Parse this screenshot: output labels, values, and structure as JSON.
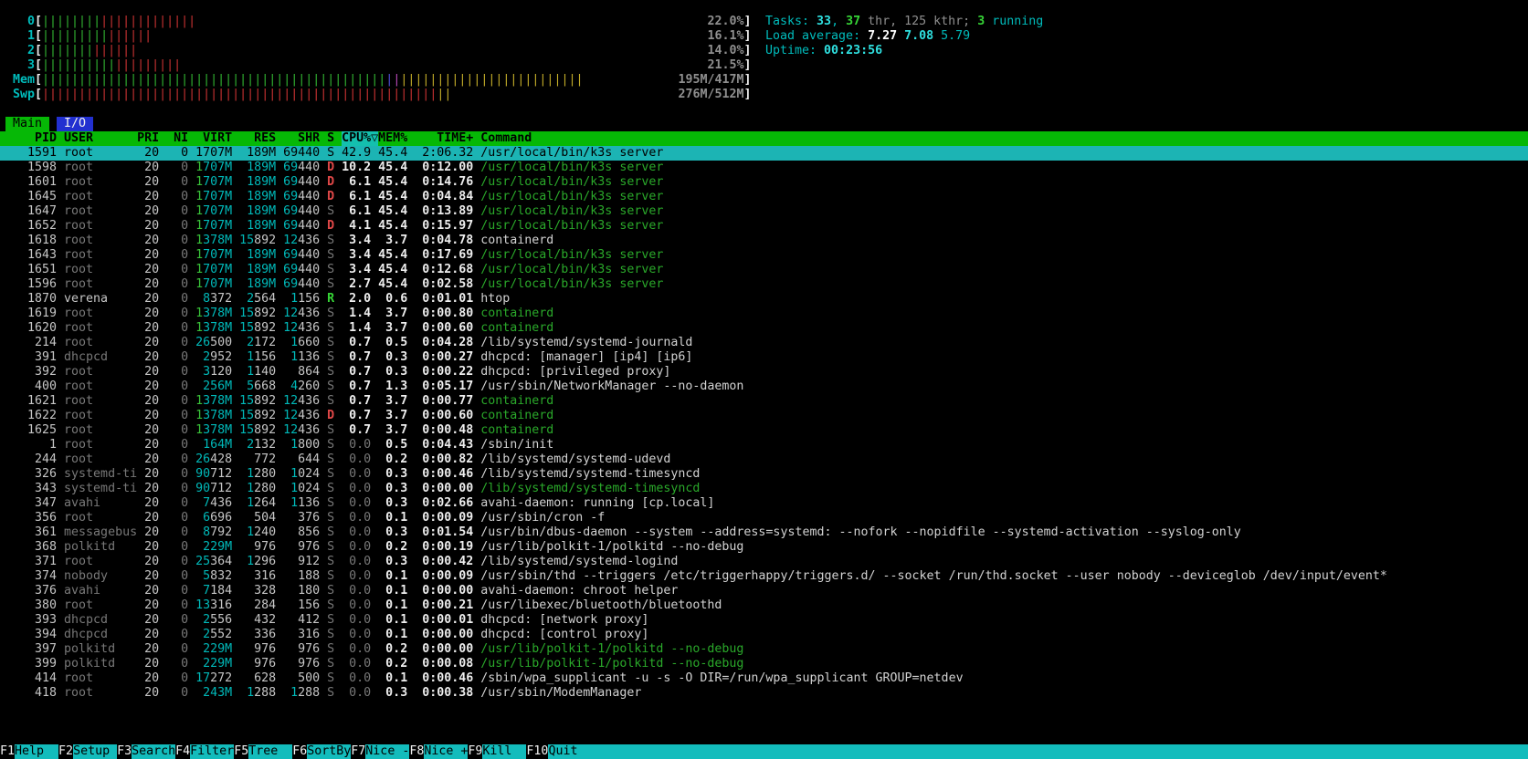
{
  "meters": {
    "cpus": [
      {
        "label": "0",
        "percent": "22.0%",
        "segments": [
          {
            "color": "bar_green",
            "count": 8
          },
          {
            "color": "bar_red",
            "count": 13
          }
        ]
      },
      {
        "label": "1",
        "percent": "16.1%",
        "segments": [
          {
            "color": "bar_green",
            "count": 9
          },
          {
            "color": "bar_red",
            "count": 6
          }
        ]
      },
      {
        "label": "2",
        "percent": "14.0%",
        "segments": [
          {
            "color": "bar_green",
            "count": 7
          },
          {
            "color": "bar_red",
            "count": 6
          }
        ]
      },
      {
        "label": "3",
        "percent": "21.5%",
        "segments": [
          {
            "color": "bar_green",
            "count": 10
          },
          {
            "color": "bar_red",
            "count": 9
          }
        ]
      }
    ],
    "mem": {
      "label": "Mem",
      "value": "195M/417M",
      "segments": [
        {
          "color": "bar_green",
          "count": 47
        },
        {
          "color": "bar_blue",
          "count": 1
        },
        {
          "color": "bar_magenta",
          "count": 1
        },
        {
          "color": "bar_yellow",
          "count": 25
        }
      ]
    },
    "swp": {
      "label": "Swp",
      "value": "276M/512M",
      "segments": [
        {
          "color": "bar_red",
          "count": 54
        },
        {
          "color": "bar_yellow",
          "count": 2
        }
      ]
    }
  },
  "summary": {
    "tasks_line": [
      {
        "t": "Tasks: ",
        "c": "label"
      },
      {
        "t": "33",
        "c": "value"
      },
      {
        "t": ", ",
        "c": "label"
      },
      {
        "t": "37",
        "c": "ok"
      },
      {
        "t": " thr, 125 kthr; ",
        "c": "shadow"
      },
      {
        "t": "3",
        "c": "ok"
      },
      {
        "t": " running",
        "c": "label"
      }
    ],
    "load_line": [
      {
        "t": "Load average: ",
        "c": "label"
      },
      {
        "t": "7.27 ",
        "c": "white"
      },
      {
        "t": "7.08 ",
        "c": "value"
      },
      {
        "t": "5.79",
        "c": "label"
      }
    ],
    "uptime_line": [
      {
        "t": "Uptime: ",
        "c": "label"
      },
      {
        "t": "00:23:56",
        "c": "value"
      }
    ]
  },
  "tabs": [
    {
      "label": "Main",
      "active": true
    },
    {
      "label": "I/O",
      "active": false
    }
  ],
  "process_table": {
    "columns": {
      "pid": "PID",
      "user": "USER",
      "pri": "PRI",
      "ni": "NI",
      "virt": "VIRT",
      "res": "RES",
      "shr": "SHR",
      "state": "S",
      "cpu": "CPU%",
      "mem": "MEM%",
      "time": "TIME+",
      "command": "Command"
    },
    "sort_column": "cpu",
    "sort_arrow": "▽",
    "rows": [
      {
        "pid": "1591",
        "user": "root",
        "pri": "20",
        "ni": "0",
        "virt": "1707M",
        "res": "189M",
        "shr": "69440",
        "state": "S",
        "cpu": "42.9",
        "mem": "45.4",
        "time": "2:06.32",
        "command": "/usr/local/bin/k3s server",
        "thread": false,
        "selected": true,
        "current_user": false
      },
      {
        "pid": "1598",
        "user": "root",
        "pri": "20",
        "ni": "0",
        "virt": "1707M",
        "res": "189M",
        "shr": "69440",
        "state": "D",
        "cpu": "10.2",
        "mem": "45.4",
        "time": "0:12.00",
        "command": "/usr/local/bin/k3s server",
        "thread": true,
        "selected": false,
        "current_user": false
      },
      {
        "pid": "1601",
        "user": "root",
        "pri": "20",
        "ni": "0",
        "virt": "1707M",
        "res": "189M",
        "shr": "69440",
        "state": "D",
        "cpu": "6.1",
        "mem": "45.4",
        "time": "0:14.76",
        "command": "/usr/local/bin/k3s server",
        "thread": true,
        "selected": false,
        "current_user": false
      },
      {
        "pid": "1645",
        "user": "root",
        "pri": "20",
        "ni": "0",
        "virt": "1707M",
        "res": "189M",
        "shr": "69440",
        "state": "D",
        "cpu": "6.1",
        "mem": "45.4",
        "time": "0:04.84",
        "command": "/usr/local/bin/k3s server",
        "thread": true,
        "selected": false,
        "current_user": false
      },
      {
        "pid": "1647",
        "user": "root",
        "pri": "20",
        "ni": "0",
        "virt": "1707M",
        "res": "189M",
        "shr": "69440",
        "state": "S",
        "cpu": "6.1",
        "mem": "45.4",
        "time": "0:13.89",
        "command": "/usr/local/bin/k3s server",
        "thread": true,
        "selected": false,
        "current_user": false
      },
      {
        "pid": "1652",
        "user": "root",
        "pri": "20",
        "ni": "0",
        "virt": "1707M",
        "res": "189M",
        "shr": "69440",
        "state": "D",
        "cpu": "4.1",
        "mem": "45.4",
        "time": "0:15.97",
        "command": "/usr/local/bin/k3s server",
        "thread": true,
        "selected": false,
        "current_user": false
      },
      {
        "pid": "1618",
        "user": "root",
        "pri": "20",
        "ni": "0",
        "virt": "1378M",
        "res": "15892",
        "shr": "12436",
        "state": "S",
        "cpu": "3.4",
        "mem": "3.7",
        "time": "0:04.78",
        "command": "containerd",
        "thread": false,
        "selected": false,
        "current_user": false
      },
      {
        "pid": "1643",
        "user": "root",
        "pri": "20",
        "ni": "0",
        "virt": "1707M",
        "res": "189M",
        "shr": "69440",
        "state": "S",
        "cpu": "3.4",
        "mem": "45.4",
        "time": "0:17.69",
        "command": "/usr/local/bin/k3s server",
        "thread": true,
        "selected": false,
        "current_user": false
      },
      {
        "pid": "1651",
        "user": "root",
        "pri": "20",
        "ni": "0",
        "virt": "1707M",
        "res": "189M",
        "shr": "69440",
        "state": "S",
        "cpu": "3.4",
        "mem": "45.4",
        "time": "0:12.68",
        "command": "/usr/local/bin/k3s server",
        "thread": true,
        "selected": false,
        "current_user": false
      },
      {
        "pid": "1596",
        "user": "root",
        "pri": "20",
        "ni": "0",
        "virt": "1707M",
        "res": "189M",
        "shr": "69440",
        "state": "S",
        "cpu": "2.7",
        "mem": "45.4",
        "time": "0:02.58",
        "command": "/usr/local/bin/k3s server",
        "thread": true,
        "selected": false,
        "current_user": false
      },
      {
        "pid": "1870",
        "user": "verena",
        "pri": "20",
        "ni": "0",
        "virt": "8372",
        "res": "2564",
        "shr": "1156",
        "state": "R",
        "cpu": "2.0",
        "mem": "0.6",
        "time": "0:01.01",
        "command": "htop",
        "thread": false,
        "selected": false,
        "current_user": true
      },
      {
        "pid": "1619",
        "user": "root",
        "pri": "20",
        "ni": "0",
        "virt": "1378M",
        "res": "15892",
        "shr": "12436",
        "state": "S",
        "cpu": "1.4",
        "mem": "3.7",
        "time": "0:00.80",
        "command": "containerd",
        "thread": true,
        "selected": false,
        "current_user": false
      },
      {
        "pid": "1620",
        "user": "root",
        "pri": "20",
        "ni": "0",
        "virt": "1378M",
        "res": "15892",
        "shr": "12436",
        "state": "S",
        "cpu": "1.4",
        "mem": "3.7",
        "time": "0:00.60",
        "command": "containerd",
        "thread": true,
        "selected": false,
        "current_user": false
      },
      {
        "pid": "214",
        "user": "root",
        "pri": "20",
        "ni": "0",
        "virt": "26500",
        "res": "2172",
        "shr": "1660",
        "state": "S",
        "cpu": "0.7",
        "mem": "0.5",
        "time": "0:04.28",
        "command": "/lib/systemd/systemd-journald",
        "thread": false,
        "selected": false,
        "current_user": false
      },
      {
        "pid": "391",
        "user": "dhcpcd",
        "pri": "20",
        "ni": "0",
        "virt": "2952",
        "res": "1156",
        "shr": "1136",
        "state": "S",
        "cpu": "0.7",
        "mem": "0.3",
        "time": "0:00.27",
        "command": "dhcpcd: [manager] [ip4] [ip6]",
        "thread": false,
        "selected": false,
        "current_user": false
      },
      {
        "pid": "392",
        "user": "root",
        "pri": "20",
        "ni": "0",
        "virt": "3120",
        "res": "1140",
        "shr": "864",
        "state": "S",
        "cpu": "0.7",
        "mem": "0.3",
        "time": "0:00.22",
        "command": "dhcpcd: [privileged proxy]",
        "thread": false,
        "selected": false,
        "current_user": false
      },
      {
        "pid": "400",
        "user": "root",
        "pri": "20",
        "ni": "0",
        "virt": "256M",
        "res": "5668",
        "shr": "4260",
        "state": "S",
        "cpu": "0.7",
        "mem": "1.3",
        "time": "0:05.17",
        "command": "/usr/sbin/NetworkManager --no-daemon",
        "thread": false,
        "selected": false,
        "current_user": false
      },
      {
        "pid": "1621",
        "user": "root",
        "pri": "20",
        "ni": "0",
        "virt": "1378M",
        "res": "15892",
        "shr": "12436",
        "state": "S",
        "cpu": "0.7",
        "mem": "3.7",
        "time": "0:00.77",
        "command": "containerd",
        "thread": true,
        "selected": false,
        "current_user": false
      },
      {
        "pid": "1622",
        "user": "root",
        "pri": "20",
        "ni": "0",
        "virt": "1378M",
        "res": "15892",
        "shr": "12436",
        "state": "D",
        "cpu": "0.7",
        "mem": "3.7",
        "time": "0:00.60",
        "command": "containerd",
        "thread": true,
        "selected": false,
        "current_user": false
      },
      {
        "pid": "1625",
        "user": "root",
        "pri": "20",
        "ni": "0",
        "virt": "1378M",
        "res": "15892",
        "shr": "12436",
        "state": "S",
        "cpu": "0.7",
        "mem": "3.7",
        "time": "0:00.48",
        "command": "containerd",
        "thread": true,
        "selected": false,
        "current_user": false
      },
      {
        "pid": "1",
        "user": "root",
        "pri": "20",
        "ni": "0",
        "virt": "164M",
        "res": "2132",
        "shr": "1800",
        "state": "S",
        "cpu": "0.0",
        "mem": "0.5",
        "time": "0:04.43",
        "command": "/sbin/init",
        "thread": false,
        "selected": false,
        "current_user": false
      },
      {
        "pid": "244",
        "user": "root",
        "pri": "20",
        "ni": "0",
        "virt": "26428",
        "res": "772",
        "shr": "644",
        "state": "S",
        "cpu": "0.0",
        "mem": "0.2",
        "time": "0:00.82",
        "command": "/lib/systemd/systemd-udevd",
        "thread": false,
        "selected": false,
        "current_user": false
      },
      {
        "pid": "326",
        "user": "systemd-ti",
        "pri": "20",
        "ni": "0",
        "virt": "90712",
        "res": "1280",
        "shr": "1024",
        "state": "S",
        "cpu": "0.0",
        "mem": "0.3",
        "time": "0:00.46",
        "command": "/lib/systemd/systemd-timesyncd",
        "thread": false,
        "selected": false,
        "current_user": false
      },
      {
        "pid": "343",
        "user": "systemd-ti",
        "pri": "20",
        "ni": "0",
        "virt": "90712",
        "res": "1280",
        "shr": "1024",
        "state": "S",
        "cpu": "0.0",
        "mem": "0.3",
        "time": "0:00.00",
        "command": "/lib/systemd/systemd-timesyncd",
        "thread": true,
        "selected": false,
        "current_user": false
      },
      {
        "pid": "347",
        "user": "avahi",
        "pri": "20",
        "ni": "0",
        "virt": "7436",
        "res": "1264",
        "shr": "1136",
        "state": "S",
        "cpu": "0.0",
        "mem": "0.3",
        "time": "0:02.66",
        "command": "avahi-daemon: running [cp.local]",
        "thread": false,
        "selected": false,
        "current_user": false
      },
      {
        "pid": "356",
        "user": "root",
        "pri": "20",
        "ni": "0",
        "virt": "6696",
        "res": "504",
        "shr": "376",
        "state": "S",
        "cpu": "0.0",
        "mem": "0.1",
        "time": "0:00.09",
        "command": "/usr/sbin/cron -f",
        "thread": false,
        "selected": false,
        "current_user": false
      },
      {
        "pid": "361",
        "user": "messagebus",
        "pri": "20",
        "ni": "0",
        "virt": "8792",
        "res": "1240",
        "shr": "856",
        "state": "S",
        "cpu": "0.0",
        "mem": "0.3",
        "time": "0:01.54",
        "command": "/usr/bin/dbus-daemon --system --address=systemd: --nofork --nopidfile --systemd-activation --syslog-only",
        "thread": false,
        "selected": false,
        "current_user": false
      },
      {
        "pid": "368",
        "user": "polkitd",
        "pri": "20",
        "ni": "0",
        "virt": "229M",
        "res": "976",
        "shr": "976",
        "state": "S",
        "cpu": "0.0",
        "mem": "0.2",
        "time": "0:00.19",
        "command": "/usr/lib/polkit-1/polkitd --no-debug",
        "thread": false,
        "selected": false,
        "current_user": false
      },
      {
        "pid": "371",
        "user": "root",
        "pri": "20",
        "ni": "0",
        "virt": "25364",
        "res": "1296",
        "shr": "912",
        "state": "S",
        "cpu": "0.0",
        "mem": "0.3",
        "time": "0:00.42",
        "command": "/lib/systemd/systemd-logind",
        "thread": false,
        "selected": false,
        "current_user": false
      },
      {
        "pid": "374",
        "user": "nobody",
        "pri": "20",
        "ni": "0",
        "virt": "5832",
        "res": "316",
        "shr": "188",
        "state": "S",
        "cpu": "0.0",
        "mem": "0.1",
        "time": "0:00.09",
        "command": "/usr/sbin/thd --triggers /etc/triggerhappy/triggers.d/ --socket /run/thd.socket --user nobody --deviceglob /dev/input/event*",
        "thread": false,
        "selected": false,
        "current_user": false
      },
      {
        "pid": "376",
        "user": "avahi",
        "pri": "20",
        "ni": "0",
        "virt": "7184",
        "res": "328",
        "shr": "180",
        "state": "S",
        "cpu": "0.0",
        "mem": "0.1",
        "time": "0:00.00",
        "command": "avahi-daemon: chroot helper",
        "thread": false,
        "selected": false,
        "current_user": false
      },
      {
        "pid": "380",
        "user": "root",
        "pri": "20",
        "ni": "0",
        "virt": "13316",
        "res": "284",
        "shr": "156",
        "state": "S",
        "cpu": "0.0",
        "mem": "0.1",
        "time": "0:00.21",
        "command": "/usr/libexec/bluetooth/bluetoothd",
        "thread": false,
        "selected": false,
        "current_user": false
      },
      {
        "pid": "393",
        "user": "dhcpcd",
        "pri": "20",
        "ni": "0",
        "virt": "2556",
        "res": "432",
        "shr": "412",
        "state": "S",
        "cpu": "0.0",
        "mem": "0.1",
        "time": "0:00.01",
        "command": "dhcpcd: [network proxy]",
        "thread": false,
        "selected": false,
        "current_user": false
      },
      {
        "pid": "394",
        "user": "dhcpcd",
        "pri": "20",
        "ni": "0",
        "virt": "2552",
        "res": "336",
        "shr": "316",
        "state": "S",
        "cpu": "0.0",
        "mem": "0.1",
        "time": "0:00.00",
        "command": "dhcpcd: [control proxy]",
        "thread": false,
        "selected": false,
        "current_user": false
      },
      {
        "pid": "397",
        "user": "polkitd",
        "pri": "20",
        "ni": "0",
        "virt": "229M",
        "res": "976",
        "shr": "976",
        "state": "S",
        "cpu": "0.0",
        "mem": "0.2",
        "time": "0:00.00",
        "command": "/usr/lib/polkit-1/polkitd --no-debug",
        "thread": true,
        "selected": false,
        "current_user": false
      },
      {
        "pid": "399",
        "user": "polkitd",
        "pri": "20",
        "ni": "0",
        "virt": "229M",
        "res": "976",
        "shr": "976",
        "state": "S",
        "cpu": "0.0",
        "mem": "0.2",
        "time": "0:00.08",
        "command": "/usr/lib/polkit-1/polkitd --no-debug",
        "thread": true,
        "selected": false,
        "current_user": false
      },
      {
        "pid": "414",
        "user": "root",
        "pri": "20",
        "ni": "0",
        "virt": "17272",
        "res": "628",
        "shr": "500",
        "state": "S",
        "cpu": "0.0",
        "mem": "0.1",
        "time": "0:00.46",
        "command": "/sbin/wpa_supplicant -u -s -O DIR=/run/wpa_supplicant GROUP=netdev",
        "thread": false,
        "selected": false,
        "current_user": false
      },
      {
        "pid": "418",
        "user": "root",
        "pri": "20",
        "ni": "0",
        "virt": "243M",
        "res": "1288",
        "shr": "1288",
        "state": "S",
        "cpu": "0.0",
        "mem": "0.3",
        "time": "0:00.38",
        "command": "/usr/sbin/ModemManager",
        "thread": false,
        "selected": false,
        "current_user": false
      }
    ]
  },
  "function_bar": [
    {
      "key": "F1",
      "label": "Help"
    },
    {
      "key": "F2",
      "label": "Setup"
    },
    {
      "key": "F3",
      "label": "Search"
    },
    {
      "key": "F4",
      "label": "Filter"
    },
    {
      "key": "F5",
      "label": "Tree"
    },
    {
      "key": "F6",
      "label": "SortBy"
    },
    {
      "key": "F7",
      "label": "Nice -"
    },
    {
      "key": "F8",
      "label": "Nice +"
    },
    {
      "key": "F9",
      "label": "Kill"
    },
    {
      "key": "F10",
      "label": "Quit"
    }
  ],
  "colors": {
    "cyan": "#00bcbc",
    "bright_cyan": "#2fe0e0",
    "ok_green": "#36d436",
    "shadow": "#8f8f8f",
    "shadow_dim": "#787878",
    "cell_cyan": "#00b9b9",
    "gb_green": "#38c038",
    "cmd_green": "#2aa82a",
    "state_red": "#e04848",
    "header_bg": "#06b806",
    "sort_bg": "#14c0ae",
    "selection_bg": "#1cb4b4",
    "tab_blue": "#2230d0",
    "function_bar_bg": "#13bcbc",
    "bar_green": "#32b432",
    "bar_red": "#c83232",
    "bar_yellow": "#c2ac28",
    "bar_blue": "#5050d8",
    "bar_magenta": "#b84ab8"
  }
}
